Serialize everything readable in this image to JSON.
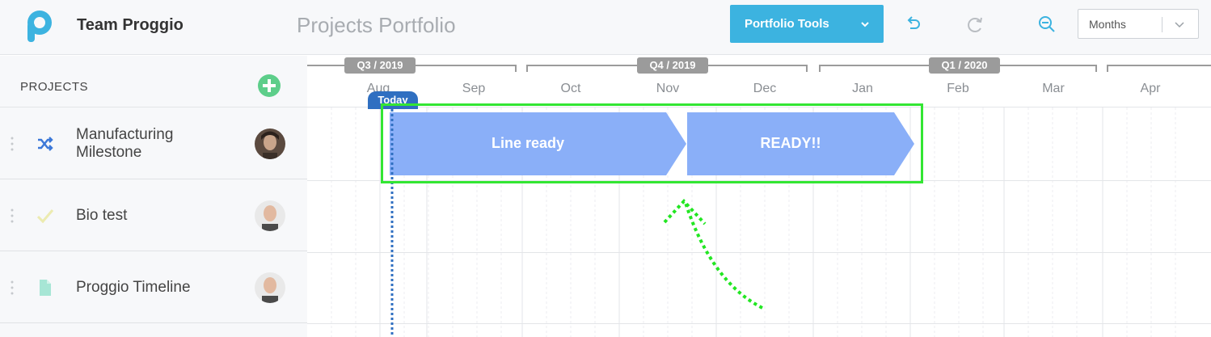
{
  "header": {
    "team_name": "Team Proggio",
    "page_title": "Projects Portfolio",
    "tools_button_label": "Portfolio Tools",
    "zoom_select_value": "Months"
  },
  "projects_panel": {
    "header_label": "PROJECTS",
    "rows": [
      {
        "name_line1": "Manufacturing",
        "name_line2": "Milestone",
        "icon": "shuffle-icon"
      },
      {
        "name": "Bio test",
        "icon": "check-icon"
      },
      {
        "name": "Proggio Timeline",
        "icon": "document-icon"
      }
    ]
  },
  "timeline": {
    "quarters": [
      "Q3 / 2019",
      "Q4 / 2019",
      "Q1 / 2020"
    ],
    "months": [
      "Aug",
      "Sep",
      "Oct",
      "Nov",
      "Dec",
      "Jan",
      "Feb",
      "Mar",
      "Apr"
    ],
    "today_label": "Today",
    "bars": [
      {
        "label": "Line ready"
      },
      {
        "label": "READY!!"
      }
    ]
  },
  "colors": {
    "accent": "#3cb3e0",
    "bar": "#8aaff8",
    "today": "#2f6fc1",
    "highlight": "#33e633",
    "add_button": "#5dce8a"
  }
}
